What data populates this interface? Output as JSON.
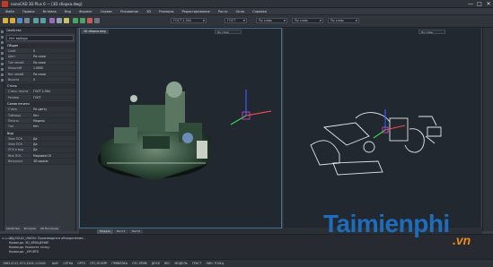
{
  "window": {
    "title": "nanoCAD 3D Plus 6 — [3D сборка.dwg]",
    "close_glyph": "✕",
    "max_glyph": "□",
    "min_glyph": "—"
  },
  "menu": [
    "Файл",
    "Правка",
    "Вставка",
    "Вид",
    "Формат",
    "Сервис",
    "Рисование",
    "3D",
    "Размеры",
    "Редактирование",
    "Растр",
    "Окна",
    "Справка"
  ],
  "toolbar": {
    "style_combo": "ГОСТ 2.304",
    "dim_combo": "ГОСТ",
    "layer_combo": "По слою",
    "linetype_combo": "По слою",
    "lineweight_combo": "По слою"
  },
  "properties": {
    "panel_title": "Свойства",
    "selector": "Нет выбора",
    "sections": [
      {
        "title": "Общие",
        "rows": [
          {
            "k": "Слой",
            "v": "0"
          },
          {
            "k": "Цвет",
            "v": "По слою"
          },
          {
            "k": "Тип линий",
            "v": "По слою"
          },
          {
            "k": "Масштаб",
            "v": "1.0000"
          },
          {
            "k": "Вес линий",
            "v": "По слою"
          },
          {
            "k": "Высота",
            "v": "0"
          }
        ]
      },
      {
        "title": "Стиль",
        "rows": [
          {
            "k": "Стиль текста",
            "v": "ГОСТ 2.304"
          },
          {
            "k": "Размер",
            "v": "ГОСТ"
          }
        ]
      },
      {
        "title": "Схема печати",
        "rows": [
          {
            "k": "Стиль",
            "v": "По цвету"
          },
          {
            "k": "Таблица",
            "v": "Нет"
          },
          {
            "k": "Печать",
            "v": "Модель"
          },
          {
            "k": "Тип",
            "v": "Нет"
          }
        ]
      },
      {
        "title": "Вид",
        "rows": [
          {
            "k": "Знак ПСК",
            "v": "Да"
          },
          {
            "k": "Знак ПСК",
            "v": "Да"
          },
          {
            "k": "ПСК в вид",
            "v": "Да"
          },
          {
            "k": "Имя ПСК",
            "v": "Мировая СК"
          },
          {
            "k": "Визуальн.",
            "v": "3D каркас"
          }
        ]
      }
    ]
  },
  "viewports": {
    "left_tab": "3D сборка.dwg",
    "left_combo": "По слою",
    "right_combo": "По слою"
  },
  "layout_tabs": [
    "Модель",
    "Лист1",
    "Лист2"
  ],
  "bottom_tabs": [
    "Свойства",
    "История",
    "3D Построен"
  ],
  "command_line": {
    "label": "Команда:",
    "lines": [
      "3D_SOLID_UNION: Производится объединение...",
      "Команда: 3D_ВРАЩЕНИЕ",
      "Команда: Укажите точку:",
      "Команда: _VPORTS"
    ]
  },
  "status": {
    "coords": "1983.4112, 871.2209, 0.0000",
    "items": [
      "ШАГ",
      "СЕТКА",
      "ОРТО",
      "ОТС-ПОЛЯР",
      "ПРИВЯЗКА",
      "ОТС-ПРИВ",
      "ДПСК",
      "ВЕС",
      "МОДЕЛЬ",
      "ТЕКСТ",
      "ЛИН. ТОЛЩ."
    ]
  },
  "watermark": {
    "text": "Taimienphi",
    "sub": ".vn"
  },
  "colors": {
    "accent_blue": "#1f6dba",
    "accent_orange": "#ed8a1b",
    "viewport_bg": "#212830"
  }
}
